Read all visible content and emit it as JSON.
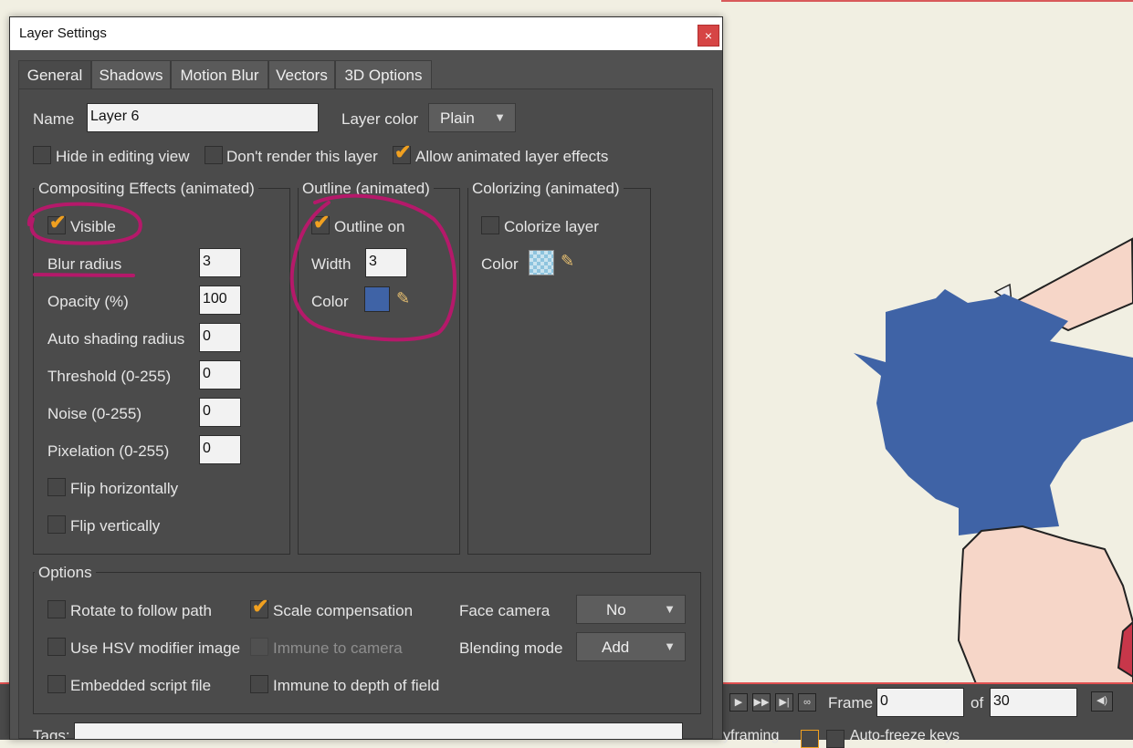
{
  "window": {
    "title": "Layer Settings",
    "close_label": "×"
  },
  "tabs": [
    "General",
    "Shadows",
    "Motion Blur",
    "Vectors",
    "3D Options"
  ],
  "general": {
    "name_label": "Name",
    "name_value": "Layer 6",
    "layer_color_label": "Layer color",
    "layer_color_value": "Plain",
    "hide_in_editing_label": "Hide in editing view",
    "hide_in_editing_checked": false,
    "dont_render_label": "Don't render this layer",
    "dont_render_checked": false,
    "allow_effects_label": "Allow animated layer effects",
    "allow_effects_checked": true
  },
  "compositing": {
    "title": "Compositing Effects (animated)",
    "visible_label": "Visible",
    "visible_checked": true,
    "fields": [
      {
        "label": "Blur radius",
        "value": "3"
      },
      {
        "label": "Opacity (%)",
        "value": "100"
      },
      {
        "label": "Auto shading radius",
        "value": "0"
      },
      {
        "label": "Threshold (0-255)",
        "value": "0"
      },
      {
        "label": "Noise (0-255)",
        "value": "0"
      },
      {
        "label": "Pixelation (0-255)",
        "value": "0"
      }
    ],
    "flip_h_label": "Flip horizontally",
    "flip_v_label": "Flip vertically"
  },
  "outline": {
    "title": "Outline (animated)",
    "on_label": "Outline on",
    "on_checked": true,
    "width_label": "Width",
    "width_value": "3",
    "color_label": "Color",
    "color_hex": "#3f63a6"
  },
  "colorizing": {
    "title": "Colorizing (animated)",
    "colorize_label": "Colorize layer",
    "colorize_checked": false,
    "color_label": "Color"
  },
  "options": {
    "title": "Options",
    "rotate_label": "Rotate to follow path",
    "scale_comp_label": "Scale compensation",
    "scale_comp_checked": true,
    "hsv_label": "Use HSV modifier image",
    "immune_camera_label": "Immune to camera",
    "embedded_label": "Embedded script file",
    "immune_dof_label": "Immune to depth of field",
    "face_camera_label": "Face camera",
    "face_camera_value": "No",
    "blending_label": "Blending mode",
    "blending_value": "Add"
  },
  "tags_label": "Tags:",
  "timeline": {
    "frame_label": "Frame",
    "frame_value": "0",
    "of_label": "of",
    "total_value": "30",
    "keyframing_label": "yframing",
    "autofreeze_label": "Auto-freeze keys"
  },
  "colors": {
    "annotation": "#b5196a",
    "accent_check": "#f0a020",
    "character_blue": "#3f63a6"
  }
}
